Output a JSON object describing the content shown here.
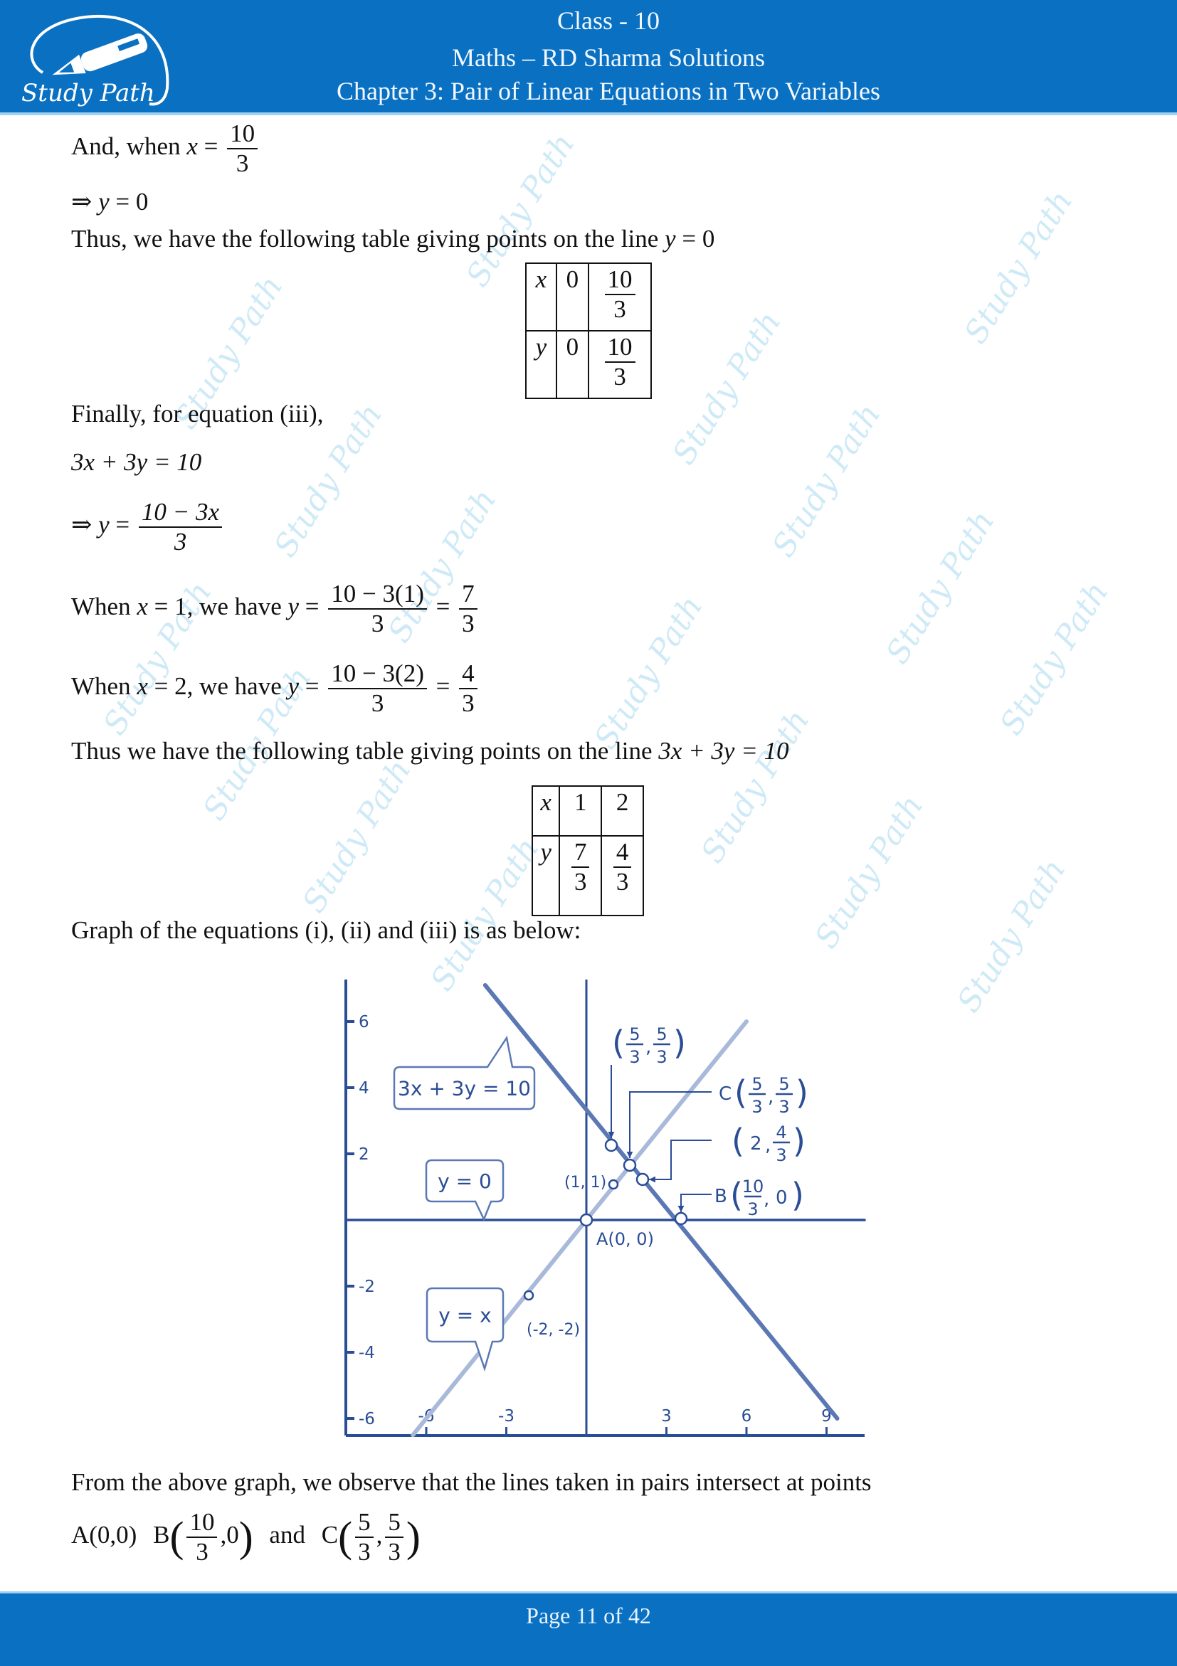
{
  "header": {
    "logo_text": "Study Path",
    "line1": "Class - 10",
    "line2": "Maths – RD Sharma Solutions",
    "line3": "Chapter 3: Pair of Linear Equations in Two Variables"
  },
  "content": {
    "l1_prefix": "And, when ",
    "l1_var": "x",
    "l1_eq": " = ",
    "l1_num": "10",
    "l1_den": "3",
    "l2": "⇒ ",
    "l2_math": "y",
    "l2_rest": " = 0",
    "l3_prefix": "Thus, we have the following table giving points on the line ",
    "l3_math": "y",
    "l3_rest": " = 0",
    "table1": {
      "row_x_label": "x",
      "row_y_label": "y",
      "x_values": [
        "0",
        {
          "num": "10",
          "den": "3"
        }
      ],
      "y_values": [
        "0",
        {
          "num": "10",
          "den": "3"
        }
      ],
      "x0": "0",
      "x1_num": "10",
      "x1_den": "3",
      "y0": "0",
      "y1_num": "10",
      "y1_den": "3"
    },
    "l4": "Finally, for equation (iii),",
    "l5": "3x + 3y = 10",
    "l6_prefix": "⇒ ",
    "l6_var": "y",
    "l6_eq": " = ",
    "l6_num": "10 − 3x",
    "l6_den": "3",
    "l7_prefix": "When ",
    "l7_var": "x",
    "l7_mid": " = 1, we have ",
    "l7_var2": "y",
    "l7_eq": " = ",
    "l7_num": "10 − 3(1)",
    "l7_den": "3",
    "l7_eq2": " = ",
    "l7_res_num": "7",
    "l7_res_den": "3",
    "l8_prefix": "When ",
    "l8_var": "x",
    "l8_mid": " = 2, we have ",
    "l8_var2": "y",
    "l8_eq": " = ",
    "l8_num": "10 − 3(2)",
    "l8_den": "3",
    "l8_eq2": " = ",
    "l8_res_num": "4",
    "l8_res_den": "3",
    "l9_prefix": "Thus we have the following table giving points on the line ",
    "l9_math": "3x + 3y = 10",
    "table2": {
      "row_x_label": "x",
      "row_y_label": "y",
      "x0": "1",
      "x1": "2",
      "y0_num": "7",
      "y0_den": "3",
      "y1_num": "4",
      "y1_den": "3"
    },
    "l10": "Graph of the equations (i), (ii) and (iii) is as below:",
    "l11": "From the above graph, we observe that the lines taken in pairs intersect at points",
    "l12_a": "A(0,0)",
    "l12_b": "B",
    "l12_b_num": "10",
    "l12_b_den": "3",
    "l12_b_rest": ",0",
    "l12_and": "and",
    "l12_c": "C",
    "l12_c_num1": "5",
    "l12_c_den1": "3",
    "l12_c_num2": "5",
    "l12_c_den2": "3"
  },
  "chart_data": {
    "type": "line",
    "title": "",
    "xlabel": "",
    "ylabel": "",
    "xlim": [
      -6,
      10
    ],
    "ylim": [
      -6.5,
      7
    ],
    "x_ticks": [
      -6,
      -3,
      3,
      6,
      9
    ],
    "x_tick_labels": [
      "-6",
      "-3",
      "3",
      "6",
      "9"
    ],
    "y_ticks": [
      6,
      4,
      2,
      -2,
      -4,
      -6
    ],
    "y_tick_labels": [
      "6",
      "4",
      "2",
      "-2",
      "-4",
      "-6"
    ],
    "grid": false,
    "series": [
      {
        "name": "3x + 3y = 10",
        "label": "3x + 3y  = 10",
        "x": [
          -4.7,
          9.4
        ],
        "y": [
          8.0,
          -6.0
        ],
        "color": "#5b78b5"
      },
      {
        "name": "y = 0",
        "label": "y = 0",
        "x": [
          -9,
          10.5
        ],
        "y": [
          0,
          0
        ],
        "color": "#2a4d96"
      },
      {
        "name": "y = x",
        "label": "y = x",
        "x": [
          -6.5,
          6.0
        ],
        "y": [
          -6.5,
          6.0
        ],
        "color": "#a9b9d9"
      }
    ],
    "points": [
      {
        "label": "A(0, 0)",
        "x": 0,
        "y": 0
      },
      {
        "label": "B",
        "x": 3.3333,
        "y": 0,
        "frac_label": {
          "num": "10",
          "den": "3",
          "rest": "0"
        }
      },
      {
        "label": "C",
        "x": 1.6667,
        "y": 1.6667,
        "frac_label": {
          "num1": "5",
          "den1": "3",
          "num2": "5",
          "den2": "3"
        }
      },
      {
        "label": "(1, 1)",
        "x": 1,
        "y": 1
      },
      {
        "label": "(2, 4/3)",
        "x": 2,
        "y": 1.3333
      },
      {
        "label": "(5/3, 5/3)",
        "x": 1.3333,
        "y": 2.3333
      },
      {
        "label": "(-2, -2)",
        "x": -2,
        "y": -2
      }
    ],
    "annotations": {
      "top_label_num1": "5",
      "top_label_den1": "3",
      "top_label_num2": "5",
      "top_label_den2": "3",
      "c_prefix": "C",
      "c_num1": "5",
      "c_den1": "3",
      "c_num2": "5",
      "c_den2": "3",
      "p2_x": "2",
      "p2_num": "4",
      "p2_den": "3",
      "b_prefix": "B",
      "b_num": "10",
      "b_den": "3",
      "b_y": "0",
      "p11": "(1, 1)",
      "pm2": "(-2, -2)",
      "origin": "A(0, 0)"
    }
  },
  "footer": {
    "page_text": "Page 11 of 42"
  },
  "watermark": "Study Path",
  "colors": {
    "brand_blue": "#0a70c2",
    "graph_blue": "#2a4d96",
    "watermark": "#bfe3f5"
  }
}
